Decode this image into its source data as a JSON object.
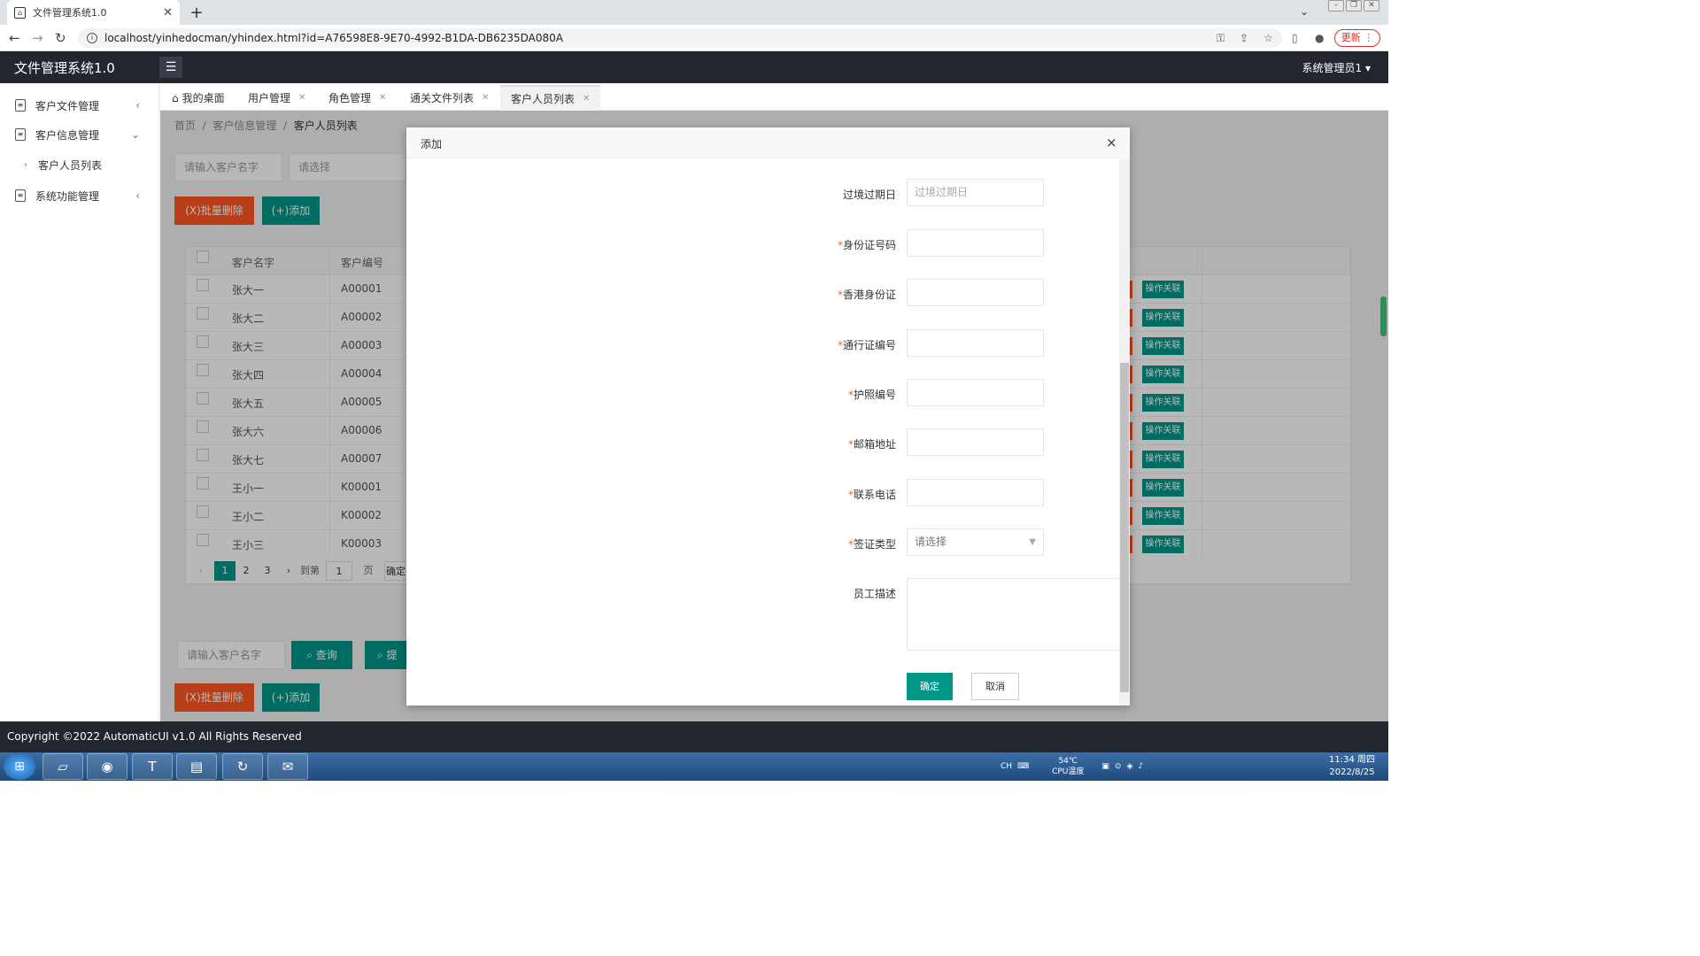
{
  "browser": {
    "tab_title": "文件管理系统1.0",
    "url": "localhost/yinhedocman/yhindex.html?id=A76598E8-9E70-4992-B1DA-DB6235DA080A",
    "update_label": "更新"
  },
  "app": {
    "title": "文件管理系统1.0",
    "user": "系统管理员1 ▾"
  },
  "sidebar": {
    "items": [
      {
        "label": "客户文件管理"
      },
      {
        "label": "客户信息管理"
      },
      {
        "label": "客户人员列表"
      },
      {
        "label": "系统功能管理"
      }
    ]
  },
  "tabs": [
    {
      "label": "我的桌面"
    },
    {
      "label": "用户管理"
    },
    {
      "label": "角色管理"
    },
    {
      "label": "通关文件列表"
    },
    {
      "label": "客户人员列表"
    }
  ],
  "breadcrumb": {
    "home": "首页",
    "sep1": "/",
    "mid": "客户信息管理",
    "sep2": "/",
    "current": "客户人员列表"
  },
  "filters": {
    "name_placeholder": "请输入客户名字",
    "select_placeholder": "请选择"
  },
  "actions": {
    "batch_delete": "(X)批量删除",
    "add": "(+)添加",
    "search": "查询",
    "submit_prefix": "提"
  },
  "table": {
    "headers": [
      "客户名字",
      "客户编号"
    ],
    "rows": [
      {
        "name": "张大一",
        "code": "A00001"
      },
      {
        "name": "张大二",
        "code": "A00002"
      },
      {
        "name": "张大三",
        "code": "A00003"
      },
      {
        "name": "张大四",
        "code": "A00004"
      },
      {
        "name": "张大五",
        "code": "A00005"
      },
      {
        "name": "张大六",
        "code": "A00006"
      },
      {
        "name": "张大七",
        "code": "A00007"
      },
      {
        "name": "王小一",
        "code": "K00001"
      },
      {
        "name": "王小二",
        "code": "K00002"
      },
      {
        "name": "王小三",
        "code": "K00003"
      }
    ],
    "row_action": "操作关联"
  },
  "pager": {
    "pages": [
      "1",
      "2",
      "3"
    ],
    "goto_label": "到第",
    "goto_value": "1",
    "page_unit": "页",
    "confirm": "确定"
  },
  "footer": "Copyright ©2022 AutomaticUI v1.0 All Rights Reserved",
  "modal": {
    "title": "添加",
    "close": "×",
    "fields": [
      {
        "label": "过境过期日",
        "placeholder": "过境过期日",
        "required": false
      },
      {
        "label": "身份证号码",
        "required": true
      },
      {
        "label": "香港身份证",
        "required": true
      },
      {
        "label": "通行证编号",
        "required": true
      },
      {
        "label": "护照编号",
        "required": true
      },
      {
        "label": "邮箱地址",
        "required": true
      },
      {
        "label": "联系电话",
        "required": true
      },
      {
        "label": "签证类型",
        "placeholder": "请选择",
        "required": true
      },
      {
        "label": "员工描述",
        "required": false
      }
    ],
    "confirm": "确定",
    "cancel": "取消"
  },
  "taskbar": {
    "lang": "CH",
    "temp": "54℃",
    "temp_label": "CPU温度",
    "time": "11:34 周四",
    "date": "2022/8/25"
  }
}
